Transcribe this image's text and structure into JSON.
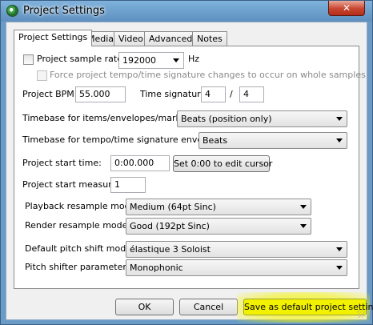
{
  "window": {
    "title": "Project Settings",
    "close_symbol": "✕",
    "close_icon": "close-icon",
    "app_icon": "reaper-logo-icon"
  },
  "tabs": [
    {
      "label": "Project Settings",
      "active": true
    },
    {
      "label": "Media",
      "active": false
    },
    {
      "label": "Video",
      "active": false
    },
    {
      "label": "Advanced",
      "active": false
    },
    {
      "label": "Notes",
      "active": false
    }
  ],
  "settings": {
    "sample_rate_label": "Project sample rate:",
    "sample_rate_checked": false,
    "sample_rate_value": "192000",
    "sample_rate_unit": "Hz",
    "force_label": "Force project tempo/time signature changes to occur on whole samples",
    "force_checked": false,
    "bpm_label": "Project BPM:",
    "bpm_value": "55.000",
    "time_sig_label": "Time signature",
    "time_sig_num": "4",
    "time_sig_sep": "/",
    "time_sig_den": "4",
    "timebase_items_label": "Timebase for items/envelopes/markers:",
    "timebase_items_value": "Beats (position only)",
    "timebase_tempo_label": "Timebase for tempo/time signature envelope:",
    "timebase_tempo_value": "Beats",
    "start_time_label": "Project start time:",
    "start_time_value": "0:00.000",
    "set_cursor_button": "Set 0:00 to edit cursor",
    "start_measure_label": "Project start measure:",
    "start_measure_value": "1",
    "playback_resample_label": "Playback resample mode:",
    "playback_resample_value": "Medium (64pt Sinc)",
    "render_resample_label": "Render resample mode:",
    "render_resample_value": "Good (192pt Sinc)",
    "pitch_shift_label": "Default pitch shift mode:",
    "pitch_shift_value": "élastique 3 Soloist",
    "pitch_param_label": "Pitch shifter parameter:",
    "pitch_param_value": "Monophonic"
  },
  "footer": {
    "ok": "OK",
    "cancel": "Cancel",
    "save_default": "Save as default project settings",
    "highlight_color": "#f2f200"
  }
}
